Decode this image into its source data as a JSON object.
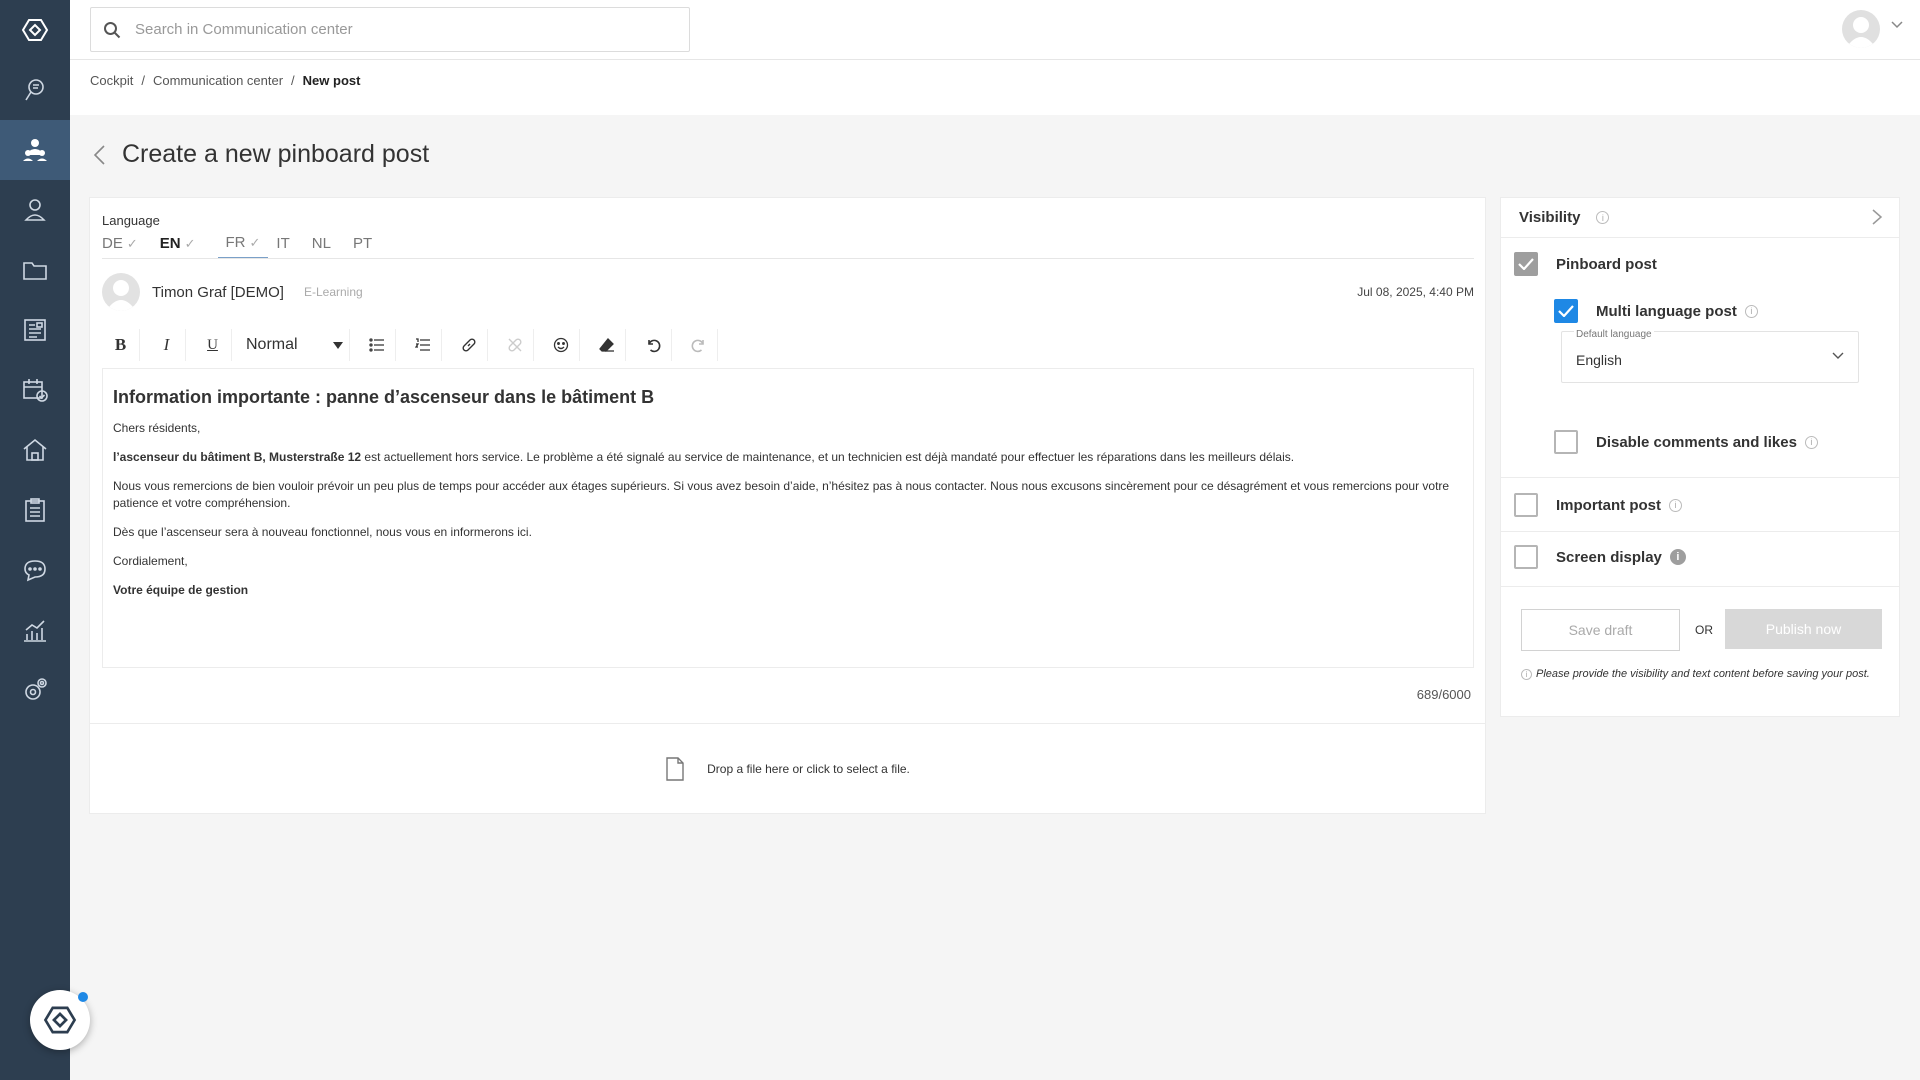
{
  "search": {
    "placeholder": "Search in Communication center"
  },
  "breadcrumb": {
    "items": [
      "Cockpit",
      "Communication center"
    ],
    "current": "New post",
    "separator": "/"
  },
  "page": {
    "title": "Create a new pinboard post"
  },
  "language": {
    "label": "Language",
    "tabs": [
      {
        "code": "DE",
        "checked": true
      },
      {
        "code": "EN",
        "checked": true
      },
      {
        "code": "FR",
        "checked": true
      },
      {
        "code": "IT"
      },
      {
        "code": "NL"
      },
      {
        "code": "PT"
      }
    ]
  },
  "author": {
    "name": "Timon Graf [DEMO]",
    "group": "E-Learning",
    "date": "Jul 08, 2025, 4:40 PM"
  },
  "toolbar": {
    "format_value": "Normal"
  },
  "editor": {
    "heading": "Information importante : panne d’ascenseur dans le bâtiment B",
    "greeting": "Chers résidents,",
    "p1_bold": "l’ascenseur du bâtiment B, Musterstraße 12",
    "p1_rest": " est actuellement hors service. Le problème a été signalé au service de maintenance, et un technicien est déjà mandaté pour effectuer les réparations dans les meilleurs délais.",
    "p2": "Nous vous remercions de bien vouloir prévoir un peu plus de temps pour accéder aux étages supérieurs. Si vous avez besoin d’aide, n’hésitez pas à nous contacter. Nous nous excusons sincèrement pour ce désagrément et vous remercions pour votre patience et votre compréhension.",
    "p3": "Dès que l’ascenseur sera à nouveau fonctionnel, nous vous en informerons ici.",
    "closing": "Cordialement,",
    "signature": "Votre équipe de gestion"
  },
  "counter": "689/6000",
  "dropzone": {
    "text": "Drop a file here or click to select a file."
  },
  "visibility": {
    "title": "Visibility",
    "pinboard_post": "Pinboard post",
    "multi_language": "Multi language post",
    "default_language_label": "Default language",
    "default_language_value": "English",
    "disable_comments": "Disable comments and likes",
    "important_post": "Important post",
    "screen_display": "Screen display",
    "save_draft": "Save draft",
    "or": "OR",
    "publish_now": "Publish now",
    "hint": "Please provide the visibility and text content before saving your post."
  },
  "colors": {
    "sidebar": "#2d3e50",
    "sidebar_active": "#3e5a77",
    "accent": "#1e88e5"
  }
}
